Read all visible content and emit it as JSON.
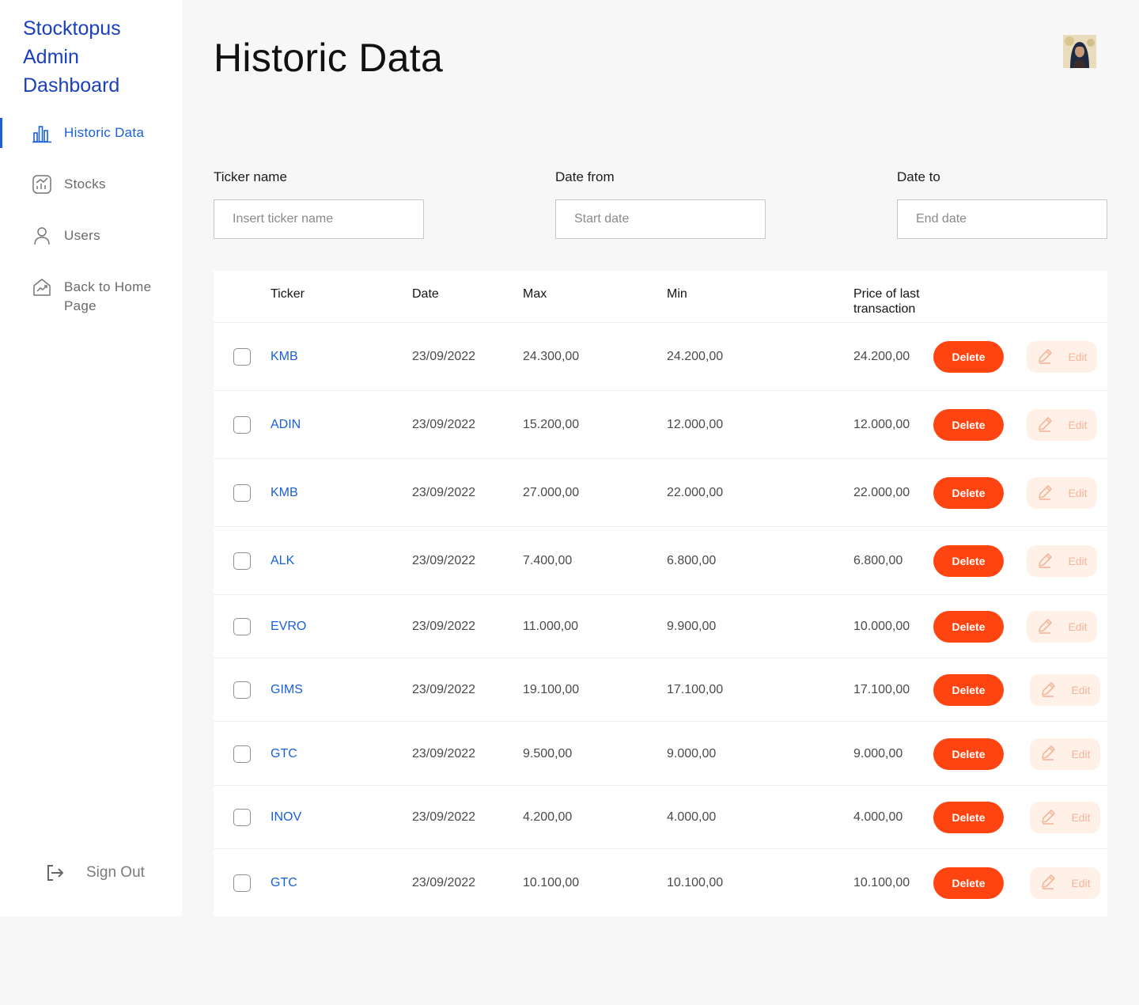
{
  "sidebar": {
    "brand": "Stocktopus Admin Dashboard",
    "items": [
      {
        "label": "Historic Data",
        "icon": "bar-chart-icon",
        "active": true
      },
      {
        "label": "Stocks",
        "icon": "stock-chart-icon",
        "active": false
      },
      {
        "label": "Users",
        "icon": "user-icon",
        "active": false
      },
      {
        "label": "Back to Home Page",
        "icon": "home-trend-icon",
        "active": false
      }
    ],
    "sign_out": "Sign Out"
  },
  "header": {
    "title": "Historic Data"
  },
  "filters": [
    {
      "label": "Ticker name",
      "placeholder": "Insert ticker name"
    },
    {
      "label": "Date from",
      "placeholder": "Start date"
    },
    {
      "label": "Date to",
      "placeholder": "End date"
    }
  ],
  "table": {
    "headers": [
      "Ticker",
      "Date",
      "Max",
      "Min",
      "Price of last transaction"
    ],
    "delete_label": "Delete",
    "edit_label": "Edit",
    "rows": [
      {
        "ticker": "KMB",
        "date": "23/09/2022",
        "max": "24.300,00",
        "min": "24.200,00",
        "last": "24.200,00"
      },
      {
        "ticker": "ADIN",
        "date": "23/09/2022",
        "max": "15.200,00",
        "min": "12.000,00",
        "last": "12.000,00"
      },
      {
        "ticker": "KMB",
        "date": "23/09/2022",
        "max": "27.000,00",
        "min": "22.000,00",
        "last": "22.000,00"
      },
      {
        "ticker": "ALK",
        "date": "23/09/2022",
        "max": "7.400,00",
        "min": "6.800,00",
        "last": "6.800,00"
      },
      {
        "ticker": "EVRO",
        "date": "23/09/2022",
        "max": "11.000,00",
        "min": "9.900,00",
        "last": "10.000,00"
      },
      {
        "ticker": "GIMS",
        "date": "23/09/2022",
        "max": "19.100,00",
        "min": "17.100,00",
        "last": "17.100,00"
      },
      {
        "ticker": "GTC",
        "date": "23/09/2022",
        "max": "9.500,00",
        "min": "9.000,00",
        "last": "9.000,00"
      },
      {
        "ticker": "INOV",
        "date": "23/09/2022",
        "max": "4.200,00",
        "min": "4.000,00",
        "last": "4.000,00"
      },
      {
        "ticker": "GTC",
        "date": "23/09/2022",
        "max": "10.100,00",
        "min": "10.100,00",
        "last": "10.100,00"
      }
    ]
  },
  "colors": {
    "accent": "#1a5fd8",
    "brand": "#1a3fbf",
    "delete": "#fe4410",
    "edit_bg": "#fff1e8",
    "edit_fg": "#f7b59a"
  }
}
